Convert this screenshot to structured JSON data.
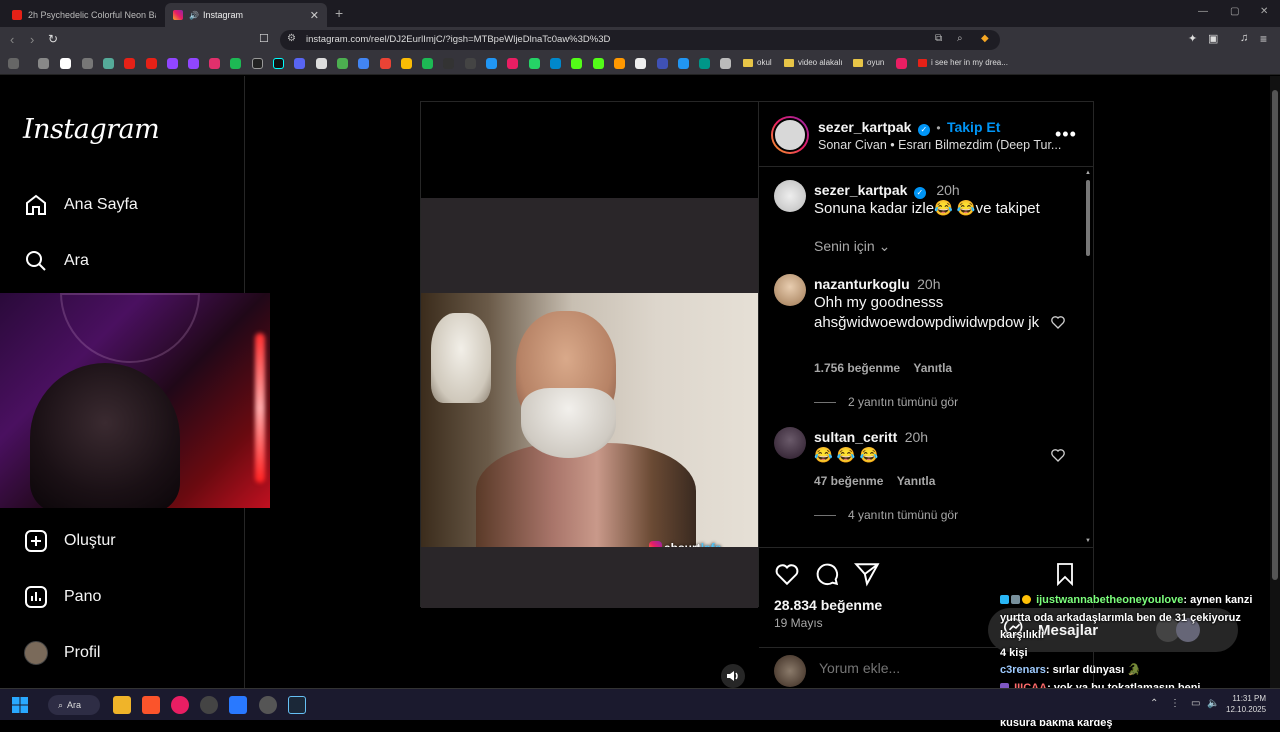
{
  "browser": {
    "tabs": [
      {
        "label": "2h Psychedelic Colorful Neon Backg...",
        "active": false
      },
      {
        "label": "Instagram",
        "active": true
      }
    ],
    "url": "instagram.com/reel/DJ2EurlImjC/?igsh=MTBpeWljeDlnaTc0aw%3D%3D",
    "bookmark_folders": [
      "okul",
      "video alakalı",
      "oyun",
      "i see her in my drea..."
    ]
  },
  "sidebar": {
    "logo": "Instagram",
    "items": [
      {
        "label": "Ana Sayfa",
        "icon": "home-icon"
      },
      {
        "label": "Ara",
        "icon": "search-icon"
      },
      {
        "label": "Oluştur",
        "icon": "create-icon"
      },
      {
        "label": "Pano",
        "icon": "dashboard-icon"
      },
      {
        "label": "Profil",
        "icon": "profile-avatar"
      }
    ]
  },
  "reel": {
    "watermark_prefix": "absurt",
    "watermark_suffix": "lafe"
  },
  "post": {
    "author": "sezer_kartpak",
    "separator": "•",
    "follow_label": "Takip Et",
    "audio": "Sonar Civan • Esrarı Bilmezdim (Deep Tur...",
    "caption": {
      "author": "sezer_kartpak",
      "time": "20h",
      "text": "Sonuna kadar izle😂 😂ve takipet"
    },
    "for_you": "Senin için",
    "comments": [
      {
        "user": "nazanturkoglu",
        "time": "20h",
        "text": "Ohh my goodnesss ahsğwidwoewdowpdiwidwpdow jk",
        "likes": "1.756 beğenme",
        "reply_label": "Yanıtla",
        "replies": "2 yanıtın tümünü gör"
      },
      {
        "user": "sultan_ceritt",
        "time": "20h",
        "text": "😂 😂 😂",
        "likes": "47 beğenme",
        "reply_label": "Yanıtla",
        "replies": "4 yanıtın tümünü gör"
      }
    ],
    "like_count": "28.834 beğenme",
    "date": "19 Mayıs",
    "comment_placeholder": "Yorum ekle..."
  },
  "messages": {
    "label": "Mesajlar"
  },
  "chat": [
    {
      "user": "ijustwannabetheoneyoulove",
      "text": ": aynen kanzi yurtta oda arkadaşlarımla ben de 31 çekiyoruz karşılıklı",
      "color": "#7cff7c"
    },
    {
      "user": "",
      "text": "4 kişi",
      "color": "#ffffff"
    },
    {
      "user": "c3renars",
      "text": ": sırlar dünyası",
      "color": "#9ecbff"
    },
    {
      "user": "IIICAA",
      "text": ": yok ya bu tokatlamasın beni",
      "color": "#ff6b6b"
    },
    {
      "user": "bingolcanavari",
      "text": ": ismi annen olan birini sikemem kusura bakma kardeş",
      "color": "#ffd54f"
    }
  ],
  "taskbar": {
    "search_label": "Ara",
    "time": "11:31 PM",
    "date": "12.10.2025"
  },
  "colors": {
    "accent": "#0095f6",
    "background": "#000000",
    "border": "#262626"
  }
}
